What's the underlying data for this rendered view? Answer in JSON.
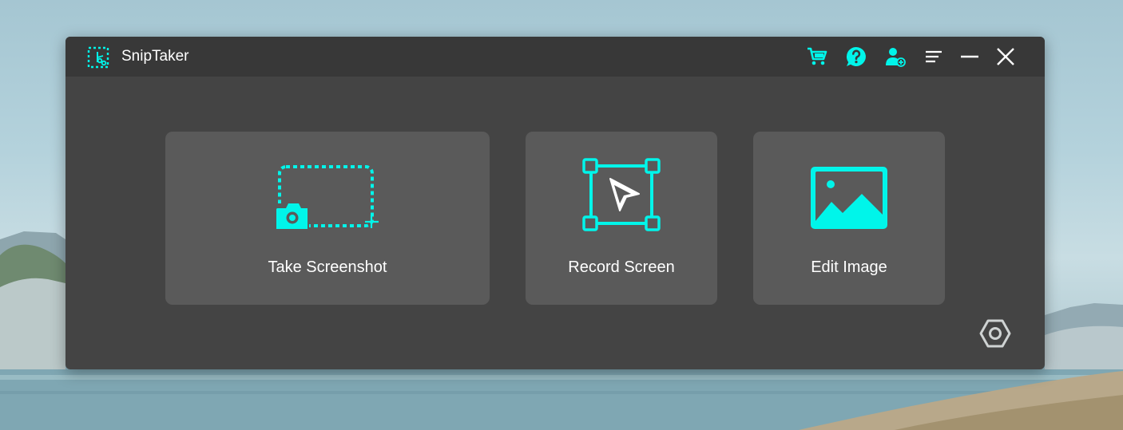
{
  "app": {
    "title": "SnipTaker",
    "accent_color": "#00f5ea"
  },
  "title_bar": {
    "buttons": [
      {
        "name": "cart-button",
        "icon": "cart-icon"
      },
      {
        "name": "help-button",
        "icon": "help-bubble-icon"
      },
      {
        "name": "account-button",
        "icon": "user-add-icon"
      },
      {
        "name": "menu-button",
        "icon": "menu-lines-icon"
      },
      {
        "name": "minimize-button",
        "icon": "minimize-icon"
      },
      {
        "name": "close-button",
        "icon": "close-icon"
      }
    ]
  },
  "actions": [
    {
      "label": "Take Screenshot",
      "icon": "screenshot-camera-icon"
    },
    {
      "label": "Record Screen",
      "icon": "record-cursor-icon"
    },
    {
      "label": "Edit Image",
      "icon": "image-icon"
    }
  ],
  "settings": {
    "icon": "settings-hexagon-icon"
  }
}
